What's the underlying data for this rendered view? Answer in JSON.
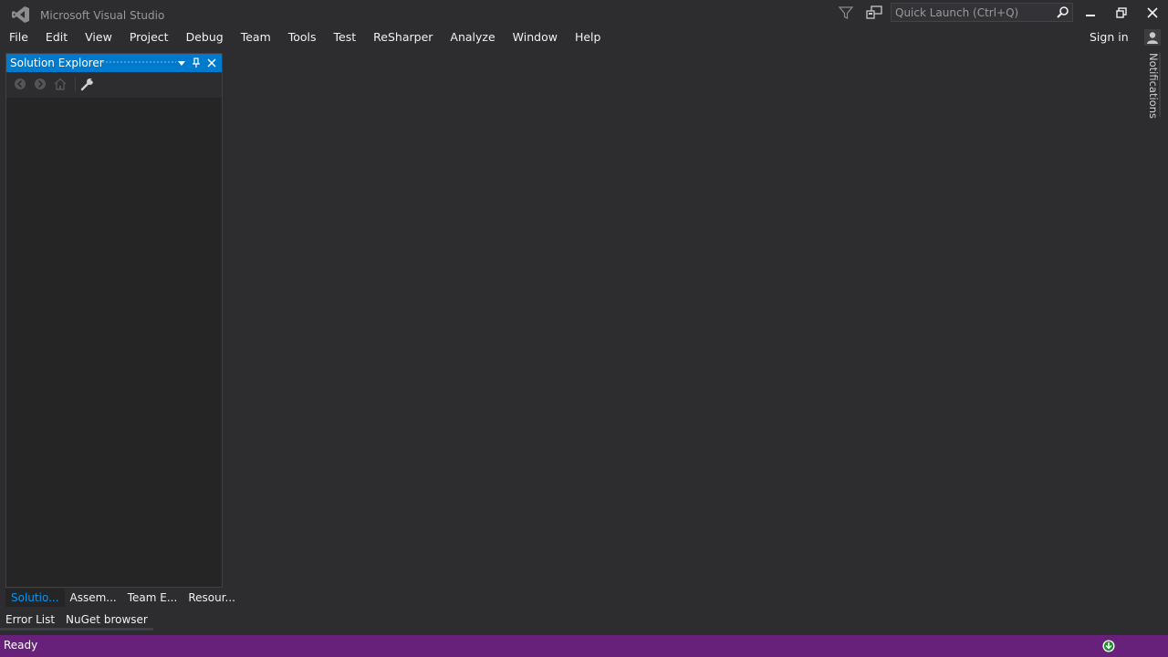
{
  "app": {
    "title": "Microsoft Visual Studio"
  },
  "quick_launch": {
    "placeholder": "Quick Launch (Ctrl+Q)"
  },
  "menu": [
    {
      "label": "File"
    },
    {
      "label": "Edit"
    },
    {
      "label": "View"
    },
    {
      "label": "Project"
    },
    {
      "label": "Debug"
    },
    {
      "label": "Team"
    },
    {
      "label": "Tools"
    },
    {
      "label": "Test"
    },
    {
      "label": "ReSharper"
    },
    {
      "label": "Analyze"
    },
    {
      "label": "Window"
    },
    {
      "label": "Help"
    }
  ],
  "account": {
    "sign_in_label": "Sign in"
  },
  "notifications": {
    "label": "Notifications"
  },
  "solution_explorer": {
    "title": "Solution Explorer",
    "toolbar_icons": [
      "back-icon",
      "forward-icon",
      "home-icon",
      "properties-wrench-icon"
    ]
  },
  "tool_tabs": [
    {
      "label": "Solutio...",
      "active": true
    },
    {
      "label": "Assem...",
      "active": false
    },
    {
      "label": "Team E...",
      "active": false
    },
    {
      "label": "Resour...",
      "active": false
    }
  ],
  "bottom_tabs": [
    {
      "label": "Error List"
    },
    {
      "label": "NuGet browser"
    }
  ],
  "status": {
    "text": "Ready"
  },
  "colors": {
    "accent": "#007acc",
    "status_bar": "#68217a",
    "background": "#2d2d30",
    "active_tab_text": "#0097fb"
  }
}
